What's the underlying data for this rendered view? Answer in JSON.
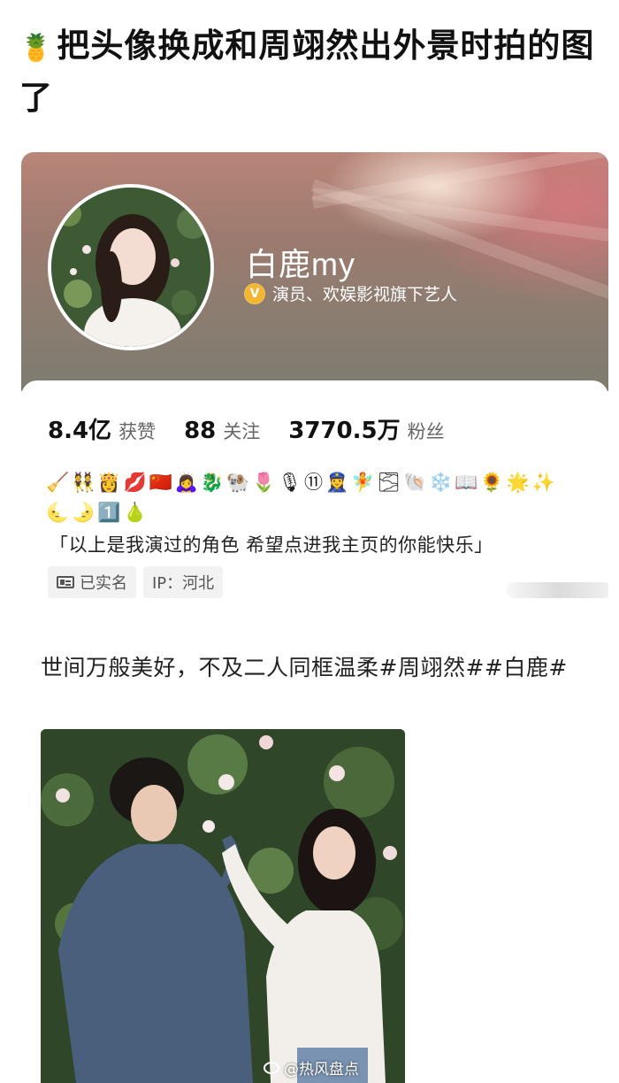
{
  "headline": {
    "emoji": "🍍",
    "text": "把头像换成和周翊然出外景时拍的图了"
  },
  "profile": {
    "name": "白鹿my",
    "verify_badge": "V",
    "verify_text": "演员、欢娱影视旗下艺人",
    "stats": [
      {
        "value": "8.4亿",
        "label": "获赞"
      },
      {
        "value": "88",
        "label": "关注"
      },
      {
        "value": "3770.5万",
        "label": "粉丝"
      }
    ],
    "emoji_line": "🧹👯👸💋🇨🇳🙇‍♀️🐉🐏🌷🎙⑪👮‍♀️🧚🌫🐚❄️📖🌻🌟✨🌜🌛1️⃣🍐",
    "bio": "「以上是我演过的角色 希望点进我主页的你能快乐」",
    "tags": {
      "realname": "已实名",
      "ip": "IP：河北"
    }
  },
  "post": {
    "text": "世间万般美好，不及二人同框温柔#周翊然##白鹿#",
    "watermark": "@热风盘点"
  },
  "colors": {
    "banner_top": "#b98579",
    "banner_bottom": "#7e7c70",
    "verify_badge": "#f2b632",
    "tag_bg": "#f2f2f2"
  }
}
